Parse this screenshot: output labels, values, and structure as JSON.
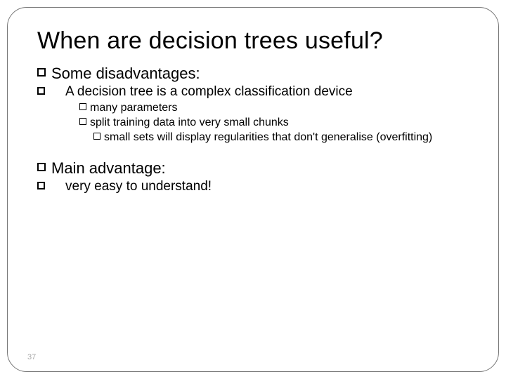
{
  "title": "When are decision trees useful?",
  "sec1": {
    "heading": "Some disadvantages:",
    "sub1": "A decision tree is a complex classification device",
    "pt1": "many parameters",
    "pt2": "split training data into very small chunks",
    "pt2a": "small sets will display regularities that don't generalise (overfitting)"
  },
  "sec2": {
    "heading": "Main advantage:",
    "sub1": "very easy to understand!"
  },
  "page_number": "37"
}
